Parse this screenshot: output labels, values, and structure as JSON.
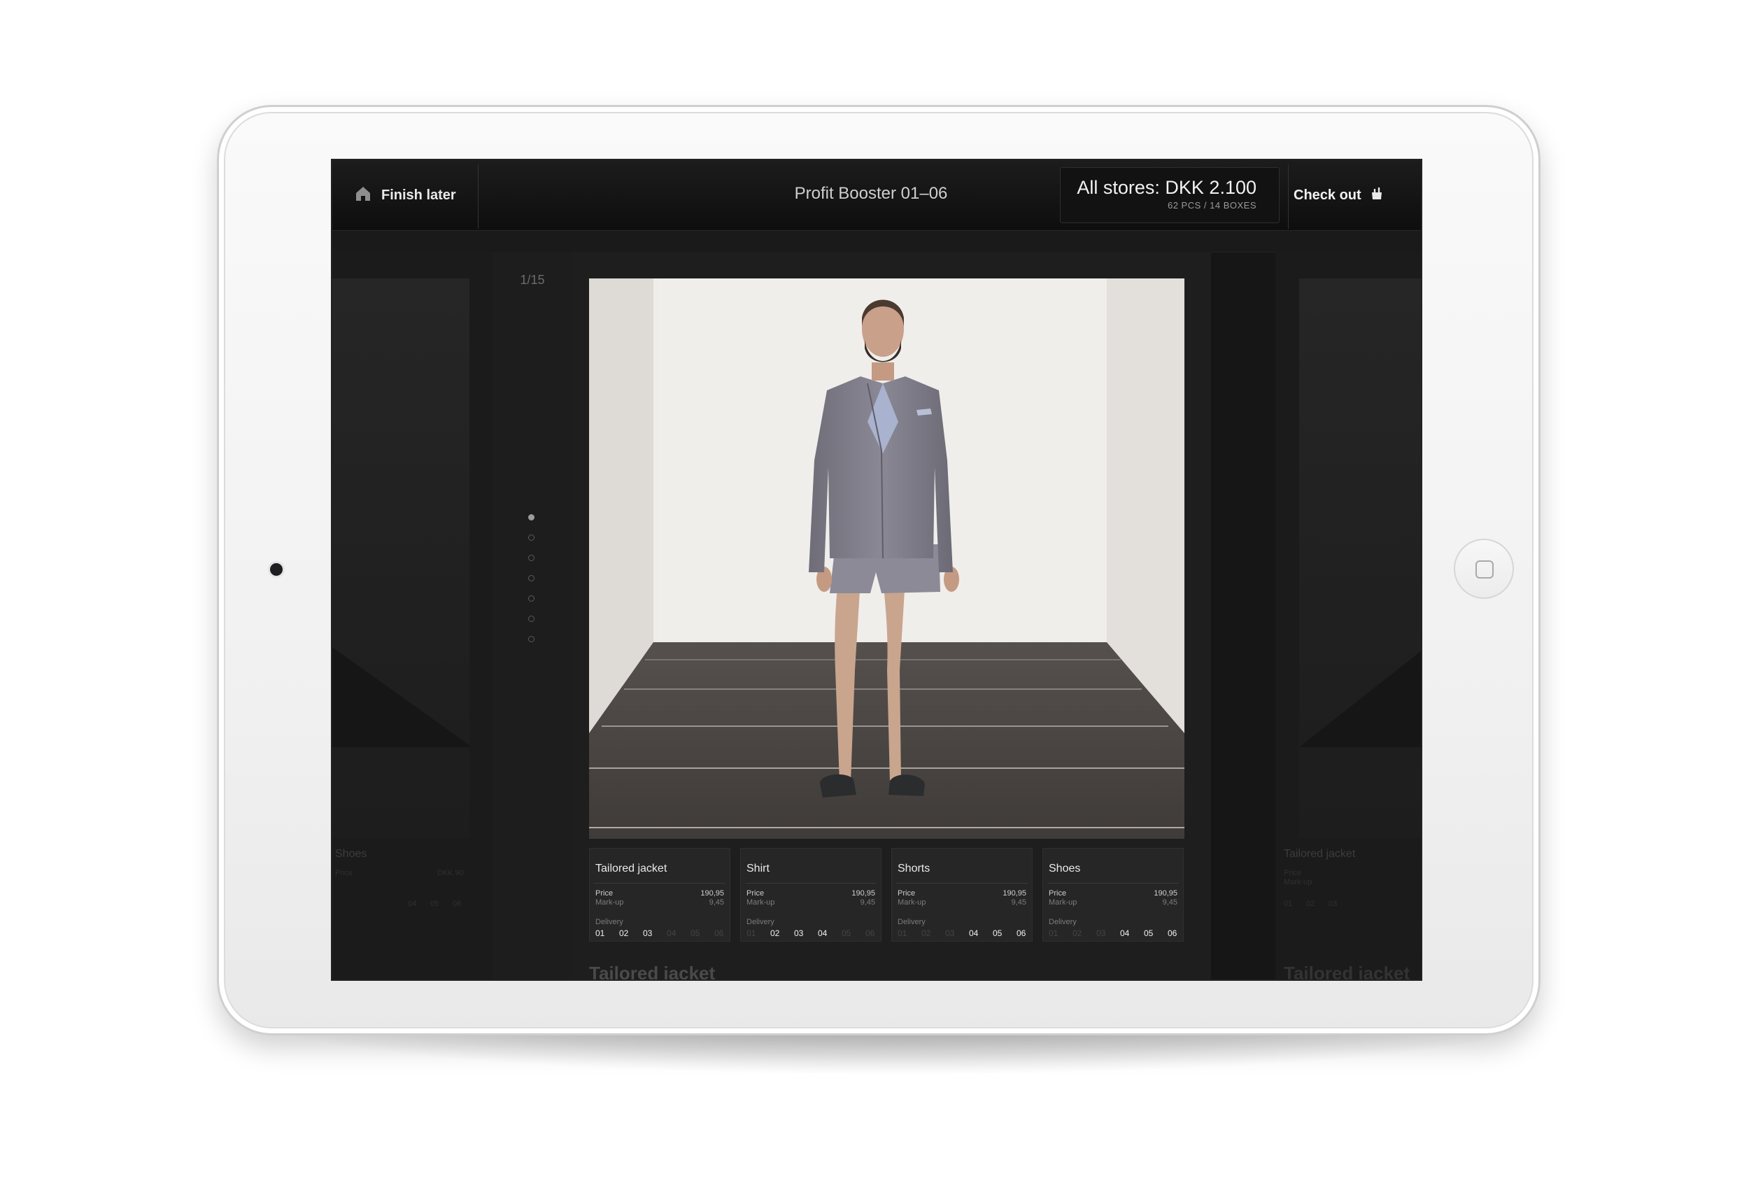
{
  "topbar": {
    "finish_later": "Finish later",
    "title": "Profit Booster 01–06",
    "stores_total": "All stores: DKK 2.100",
    "stores_sub": "62 PCS / 14 BOXES",
    "checkout": "Check out"
  },
  "pager": {
    "counter": "1/15",
    "dots_count": 7,
    "active_dot": 0
  },
  "items": [
    {
      "name": "Tailored jacket",
      "price_label": "Price",
      "price": "190,95",
      "markup_label": "Mark-up",
      "markup": "9,45",
      "delivery_label": "Delivery",
      "weeks": [
        {
          "label": "01",
          "on": true
        },
        {
          "label": "02",
          "on": true
        },
        {
          "label": "03",
          "on": true
        },
        {
          "label": "04",
          "on": false
        },
        {
          "label": "05",
          "on": false
        },
        {
          "label": "06",
          "on": false
        }
      ]
    },
    {
      "name": "Shirt",
      "price_label": "Price",
      "price": "190,95",
      "markup_label": "Mark-up",
      "markup": "9,45",
      "delivery_label": "Delivery",
      "weeks": [
        {
          "label": "01",
          "on": false
        },
        {
          "label": "02",
          "on": true
        },
        {
          "label": "03",
          "on": true
        },
        {
          "label": "04",
          "on": true
        },
        {
          "label": "05",
          "on": false
        },
        {
          "label": "06",
          "on": false
        }
      ]
    },
    {
      "name": "Shorts",
      "price_label": "Price",
      "price": "190,95",
      "markup_label": "Mark-up",
      "markup": "9,45",
      "delivery_label": "Delivery",
      "weeks": [
        {
          "label": "01",
          "on": false
        },
        {
          "label": "02",
          "on": false
        },
        {
          "label": "03",
          "on": false
        },
        {
          "label": "04",
          "on": true
        },
        {
          "label": "05",
          "on": true
        },
        {
          "label": "06",
          "on": true
        }
      ]
    },
    {
      "name": "Shoes",
      "price_label": "Price",
      "price": "190,95",
      "markup_label": "Mark-up",
      "markup": "9,45",
      "delivery_label": "Delivery",
      "weeks": [
        {
          "label": "01",
          "on": false
        },
        {
          "label": "02",
          "on": false
        },
        {
          "label": "03",
          "on": false
        },
        {
          "label": "04",
          "on": true
        },
        {
          "label": "05",
          "on": true
        },
        {
          "label": "06",
          "on": true
        }
      ]
    }
  ],
  "next_title": "Tailored jacket",
  "ghost_left": {
    "name": "Shoes",
    "price_label": "Price",
    "price": "DKK 90",
    "weeks": [
      "04",
      "05",
      "06"
    ],
    "bottom_title": ""
  },
  "ghost_right": {
    "name": "Tailored jacket",
    "price_label": "Price",
    "markup_label": "Mark-up",
    "weeks": [
      "01",
      "02",
      "03"
    ],
    "bottom_title": "Tailored jacket"
  },
  "icons": {
    "home": "home-icon",
    "checkout": "shopping-bag-icon",
    "device_home": "device-home-button-icon"
  },
  "colors": {
    "screen_bg": "#161616",
    "topbar_bg": "#0e0e0e",
    "text_primary": "#f2f2f2",
    "text_muted": "#7c7c7c",
    "device_frame": "#f1f1f1"
  }
}
